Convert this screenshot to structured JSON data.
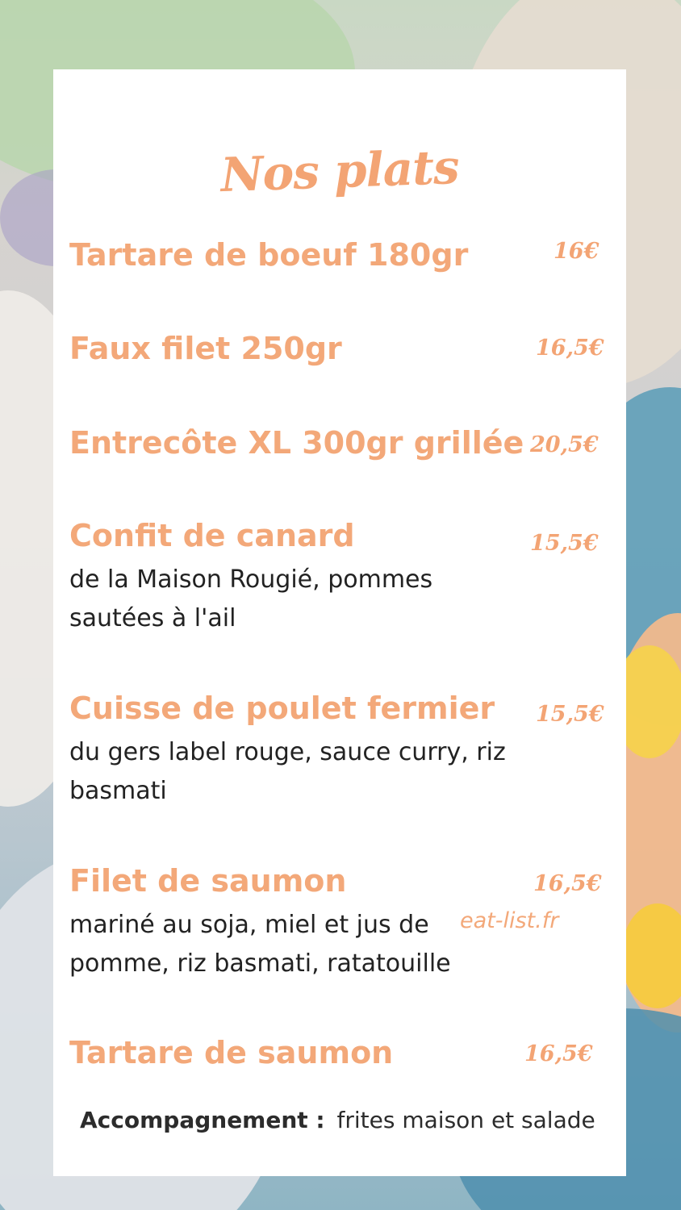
{
  "menu": {
    "title": "Nos plats",
    "items": [
      {
        "name": "Tartare de boeuf 180gr",
        "price": "16€"
      },
      {
        "name": "Faux filet 250gr",
        "price": "16,5€"
      },
      {
        "name": "Entrecôte XL 300gr grillée",
        "price": "20,5€"
      },
      {
        "name": "Confit de canard",
        "price": "15,5€",
        "desc": "de la Maison Rougié, pommes sautées à l'ail"
      },
      {
        "name": "Cuisse de poulet fermier",
        "price": "15,5€",
        "desc": "du gers label rouge, sauce curry, riz basmati"
      },
      {
        "name": "Filet de saumon",
        "price": "16,5€",
        "desc": "mariné au soja, miel et jus de pomme, riz basmati, ratatouille"
      },
      {
        "name": "Tartare de saumon",
        "price": "16,5€"
      }
    ],
    "footer": {
      "label": "Accompagnement :",
      "value": "frites maison et salade"
    },
    "credit": "eat-list.fr"
  },
  "colors": {
    "accent": "#f3a474",
    "text": "#222222",
    "card": "#ffffff"
  }
}
